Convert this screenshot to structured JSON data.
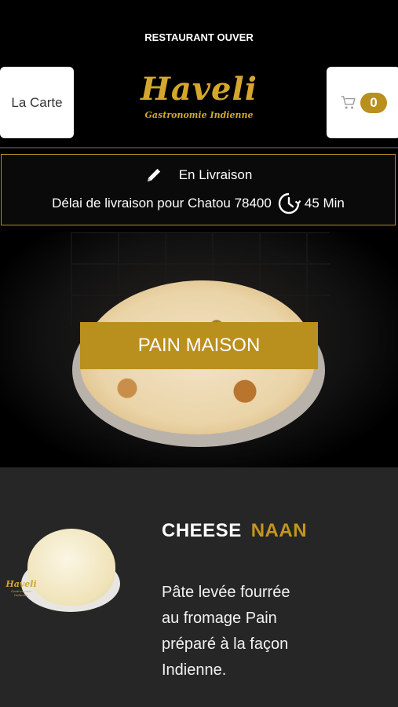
{
  "status_bar": {
    "text": "RESTAURANT OUVER"
  },
  "header": {
    "menu_button_label": "La Carte",
    "logo_title": "Haveli",
    "logo_subtitle": "Gastronomie Indienne",
    "cart_count": "0",
    "accent_color": "#b98f1e"
  },
  "delivery": {
    "mode_label": "En Livraison",
    "delay_label": "Délai de livraison pour Chatou 78400",
    "delay_time": "45 Min",
    "icons": [
      "pencil-icon",
      "clock-icon"
    ]
  },
  "hero": {
    "category_label": "PAIN MAISON"
  },
  "product": {
    "title_word1": "CHEESE",
    "title_word2": "NAAN",
    "description": "Pâte levée fourrée au fromage  Pain préparé à la façon Indienne.",
    "image_logo_title": "Haveli",
    "image_logo_subtitle": "Gastronomie Indienne"
  }
}
